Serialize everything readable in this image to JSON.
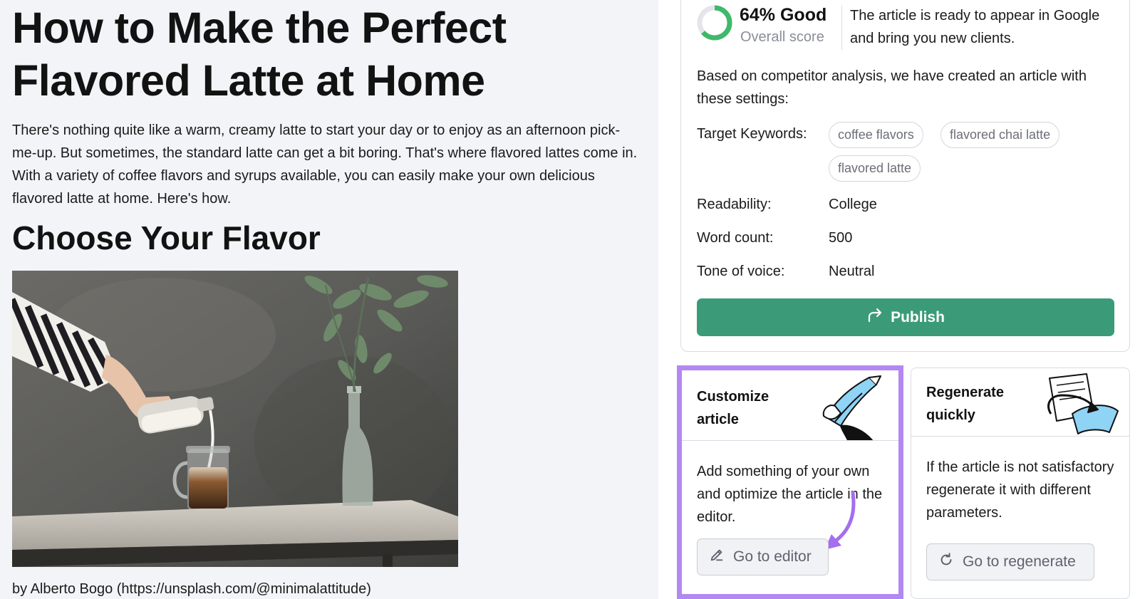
{
  "article": {
    "title": "How to Make the Perfect Flavored Latte at Home",
    "intro": "There's nothing quite like a warm, creamy latte to start your day or to enjoy as an afternoon pick-me-up. But sometimes, the standard latte can get a bit boring. That's where flavored lattes come in. With a variety of coffee flavors and syrups available, you can easily make your own delicious flavored latte at home. Here's how.",
    "heading": "Choose Your Flavor",
    "caption": "by Alberto Bogo (https://unsplash.com/@minimalattitude)"
  },
  "score": {
    "value": 64,
    "headline": "64% Good",
    "label": "Overall score",
    "message": "The article is ready to appear in Google and bring you new clients.",
    "color": "#3fb86b"
  },
  "settings": {
    "intro": "Based on competitor analysis, we have created an article with these settings:",
    "keywords_label": "Target Keywords:",
    "keywords": [
      "coffee flavors",
      "flavored chai latte",
      "flavored latte"
    ],
    "readability_label": "Readability:",
    "readability": "College",
    "wordcount_label": "Word count:",
    "wordcount": "500",
    "tone_label": "Tone of voice:",
    "tone": "Neutral"
  },
  "publish": {
    "label": "Publish",
    "icon": "share-arrow-icon",
    "color": "#3b9b78"
  },
  "customize": {
    "title": "Customize article",
    "body": "Add something of your own and optimize the article in the editor.",
    "button": "Go to editor",
    "icon": "pencil-icon",
    "highlight_color": "#b388f2"
  },
  "regenerate": {
    "title": "Regenerate quickly",
    "body": "If the article is not satisfactory regenerate it with different parameters.",
    "button": "Go to regenerate",
    "icon": "refresh-icon"
  }
}
